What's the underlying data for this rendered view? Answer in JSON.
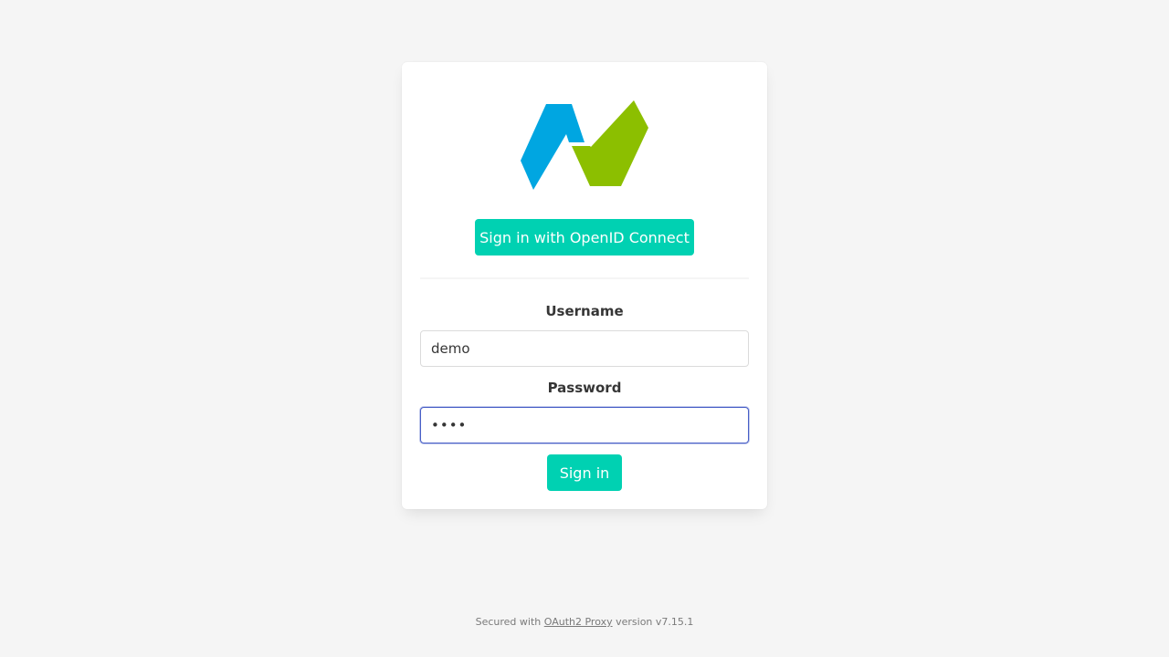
{
  "theme": {
    "accent": "#00d1b2",
    "logo_blue": "#00a6e1",
    "logo_green": "#8cbf00",
    "background": "#f5f5f5"
  },
  "logo": {
    "icon": "brand-logo-icon"
  },
  "oidc": {
    "button_label": "Sign in with OpenID Connect"
  },
  "form": {
    "username_label": "Username",
    "username_value": "demo",
    "password_label": "Password",
    "password_value": "demo",
    "signin_label": "Sign in"
  },
  "footer": {
    "prefix": "Secured with",
    "link_text": "OAuth2 Proxy",
    "suffix": "version v7.15.1"
  }
}
